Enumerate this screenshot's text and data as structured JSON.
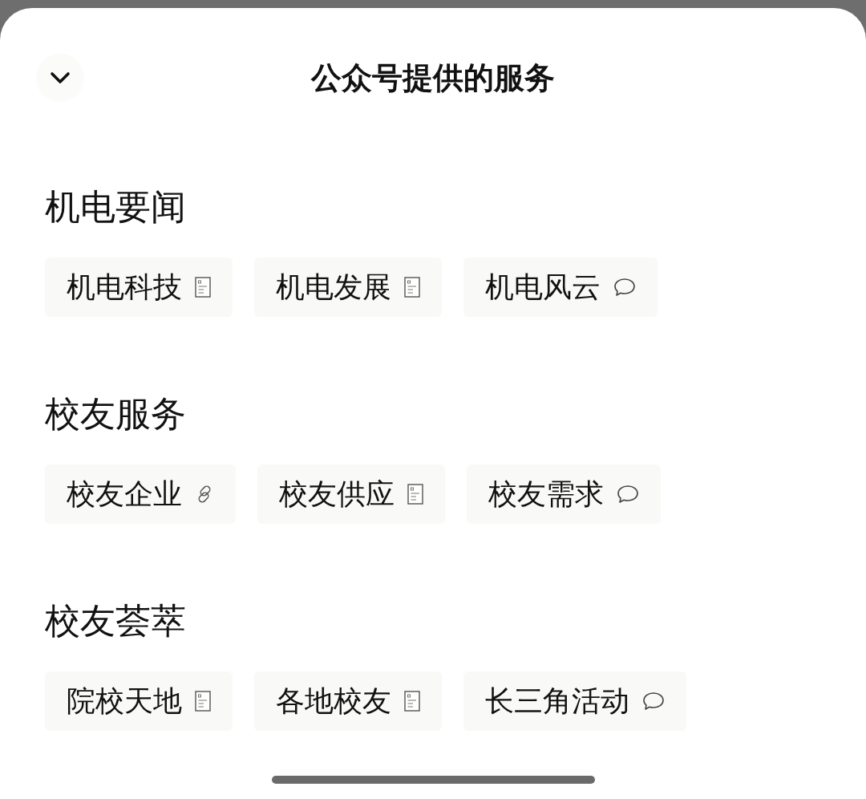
{
  "header": {
    "title": "公众号提供的服务"
  },
  "sections": [
    {
      "title": "机电要闻",
      "items": [
        {
          "label": "机电科技",
          "kind": "article"
        },
        {
          "label": "机电发展",
          "kind": "article"
        },
        {
          "label": "机电风云",
          "kind": "message"
        }
      ]
    },
    {
      "title": "校友服务",
      "items": [
        {
          "label": "校友企业",
          "kind": "link"
        },
        {
          "label": "校友供应",
          "kind": "article"
        },
        {
          "label": "校友需求",
          "kind": "message"
        }
      ]
    },
    {
      "title": "校友荟萃",
      "items": [
        {
          "label": "院校天地",
          "kind": "article"
        },
        {
          "label": "各地校友",
          "kind": "article"
        },
        {
          "label": "长三角活动",
          "kind": "message"
        }
      ]
    }
  ]
}
